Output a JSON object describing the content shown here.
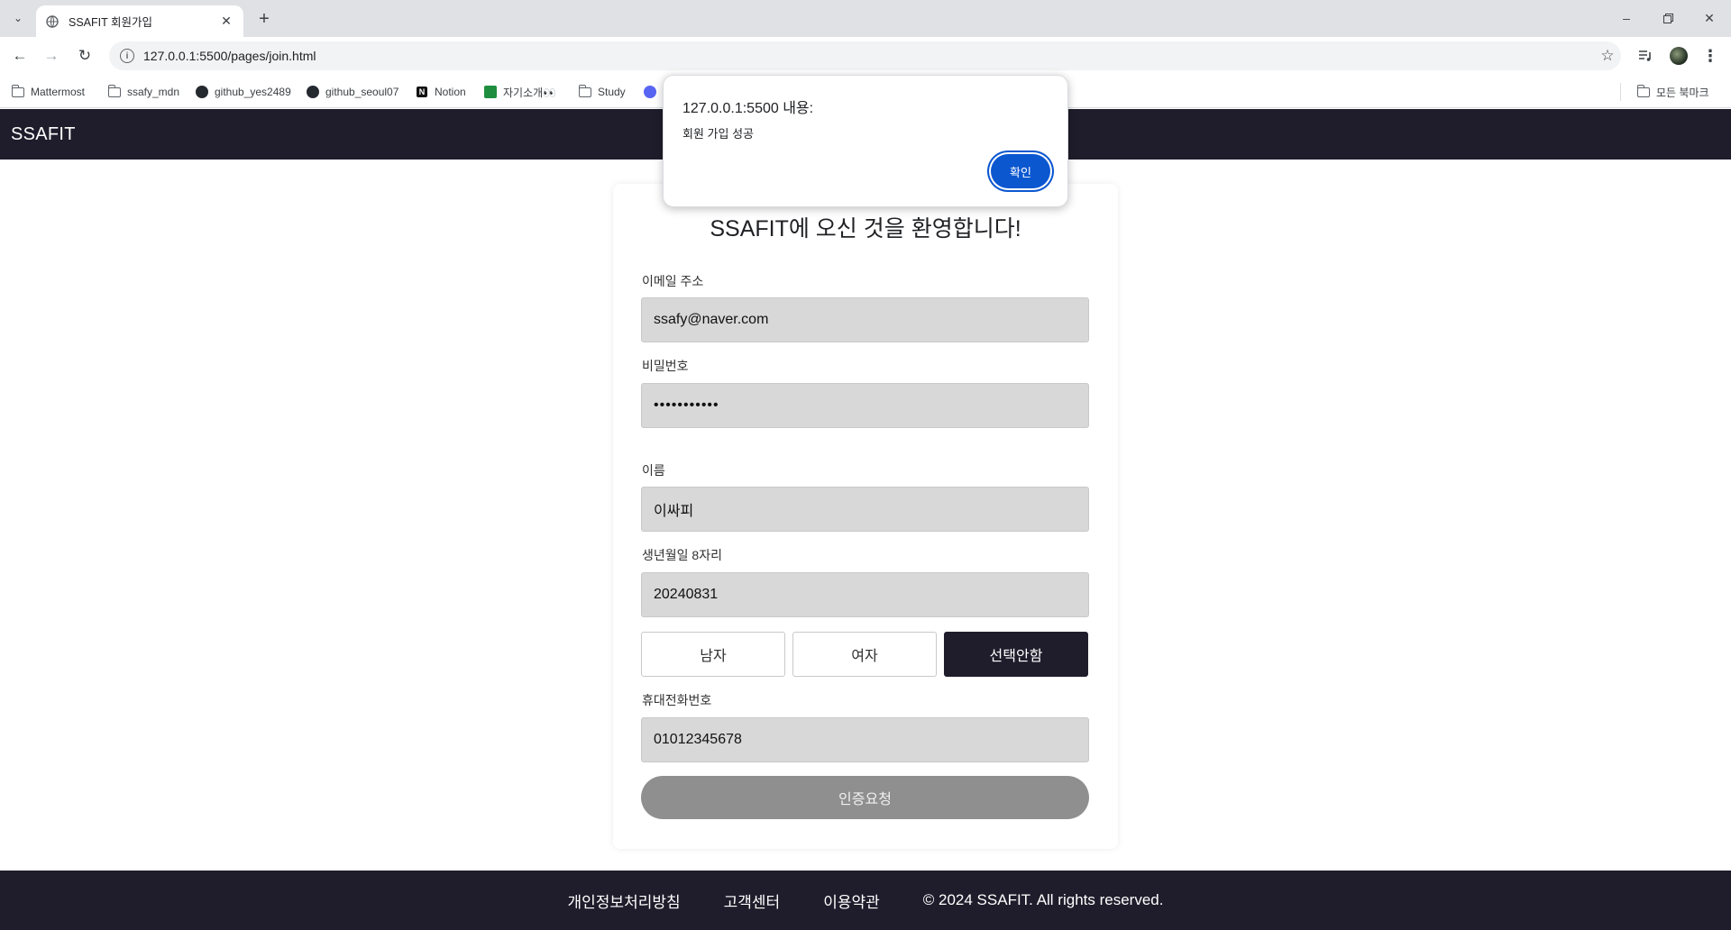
{
  "browser": {
    "tab_title": "SSAFIT 회원가입",
    "url": "127.0.0.1:5500/pages/join.html",
    "bookmarks": [
      {
        "label": "Mattermost",
        "icon": "folder-icon"
      },
      {
        "label": "ssafy_mdn",
        "icon": "folder-icon"
      },
      {
        "label": "github_yes2489",
        "icon": "github-icon"
      },
      {
        "label": "github_seoul07",
        "icon": "github-icon"
      },
      {
        "label": "Notion",
        "icon": "notion-icon"
      },
      {
        "label": "자기소개👀",
        "icon": "sheets-icon"
      },
      {
        "label": "Study",
        "icon": "folder-icon"
      }
    ],
    "all_bookmarks_label": "모든 북마크"
  },
  "header": {
    "logo": "SSAFIT"
  },
  "form": {
    "title": "SSAFIT에 오신 것을 환영합니다!",
    "email_label": "이메일 주소",
    "email_value": "ssafy@naver.com",
    "password_label": "비밀번호",
    "password_value": "•••••••••••",
    "name_label": "이름",
    "name_value": "이싸피",
    "birth_label": "생년월일 8자리",
    "birth_value": "20240831",
    "gender_options": [
      "남자",
      "여자",
      "선택안함"
    ],
    "gender_selected": "선택안함",
    "phone_label": "휴대전화번호",
    "phone_value": "01012345678",
    "verify_button": "인증요청"
  },
  "footer": {
    "privacy": "개인정보처리방침",
    "support": "고객센터",
    "terms": "이용약관",
    "copyright": "© 2024 SSAFIT. All rights reserved."
  },
  "dialog": {
    "origin": "127.0.0.1:5500 내용:",
    "message": "회원 가입 성공",
    "ok_button": "확인"
  },
  "colors": {
    "header_bg": "#1f1d2b",
    "field_bg": "#d8d8d8",
    "verify_button_bg": "#8f8f8f",
    "dialog_button_bg": "#0b57d0"
  }
}
